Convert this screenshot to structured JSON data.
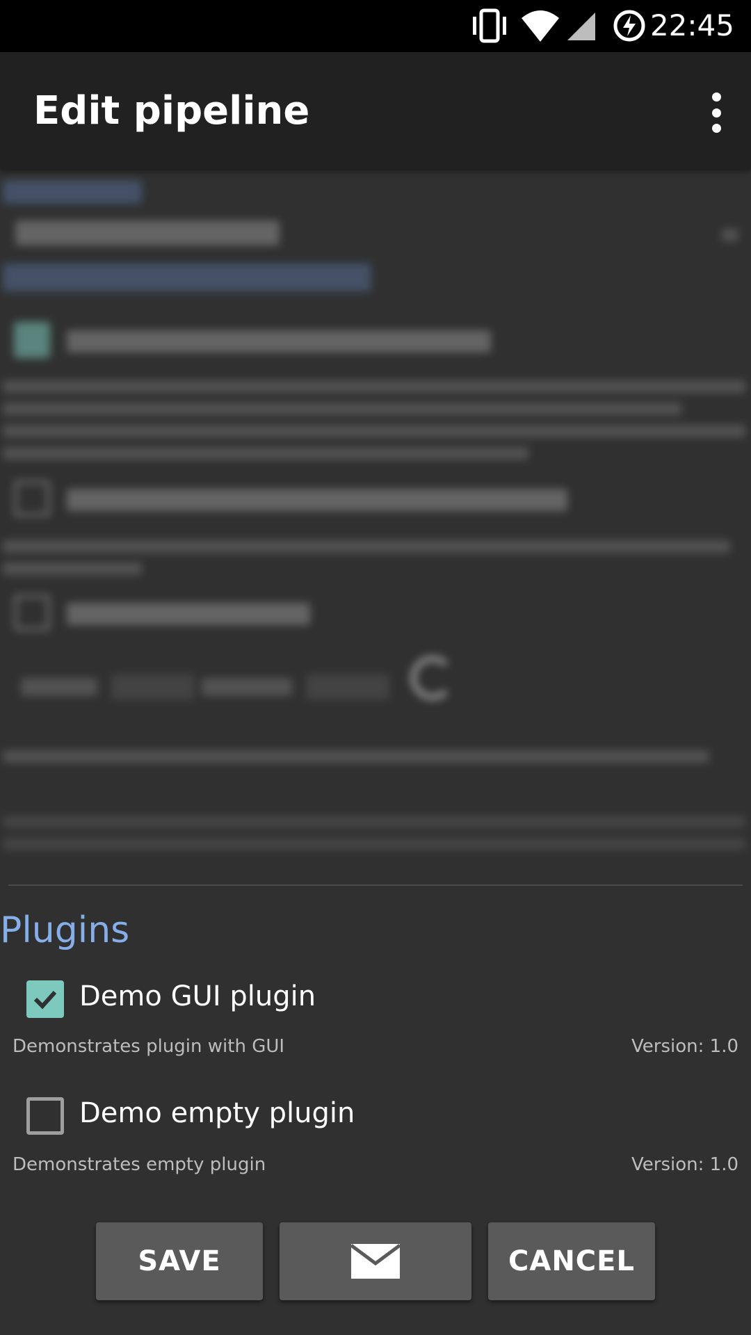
{
  "status_bar": {
    "time": "22:45",
    "icons": [
      "vibrate-icon",
      "wifi-icon",
      "signal-icon",
      "battery-saver-icon"
    ]
  },
  "app_bar": {
    "title": "Edit pipeline",
    "menu_icon": "overflow-menu-icon"
  },
  "plugins": {
    "section_title": "Plugins",
    "items": [
      {
        "name": "Demo GUI plugin",
        "description": "Demonstrates plugin with GUI",
        "version": "Version: 1.0",
        "checked": true
      },
      {
        "name": "Demo empty plugin",
        "description": "Demonstrates empty plugin",
        "version": "Version: 1.0",
        "checked": false
      }
    ]
  },
  "buttons": {
    "save_label": "SAVE",
    "mail_icon": "mail-icon",
    "cancel_label": "CANCEL"
  },
  "colors": {
    "accent": "#7ec9bd",
    "section_title": "#86aee8",
    "background": "#303030",
    "app_bar": "#212121",
    "button": "#5a5a5a"
  }
}
